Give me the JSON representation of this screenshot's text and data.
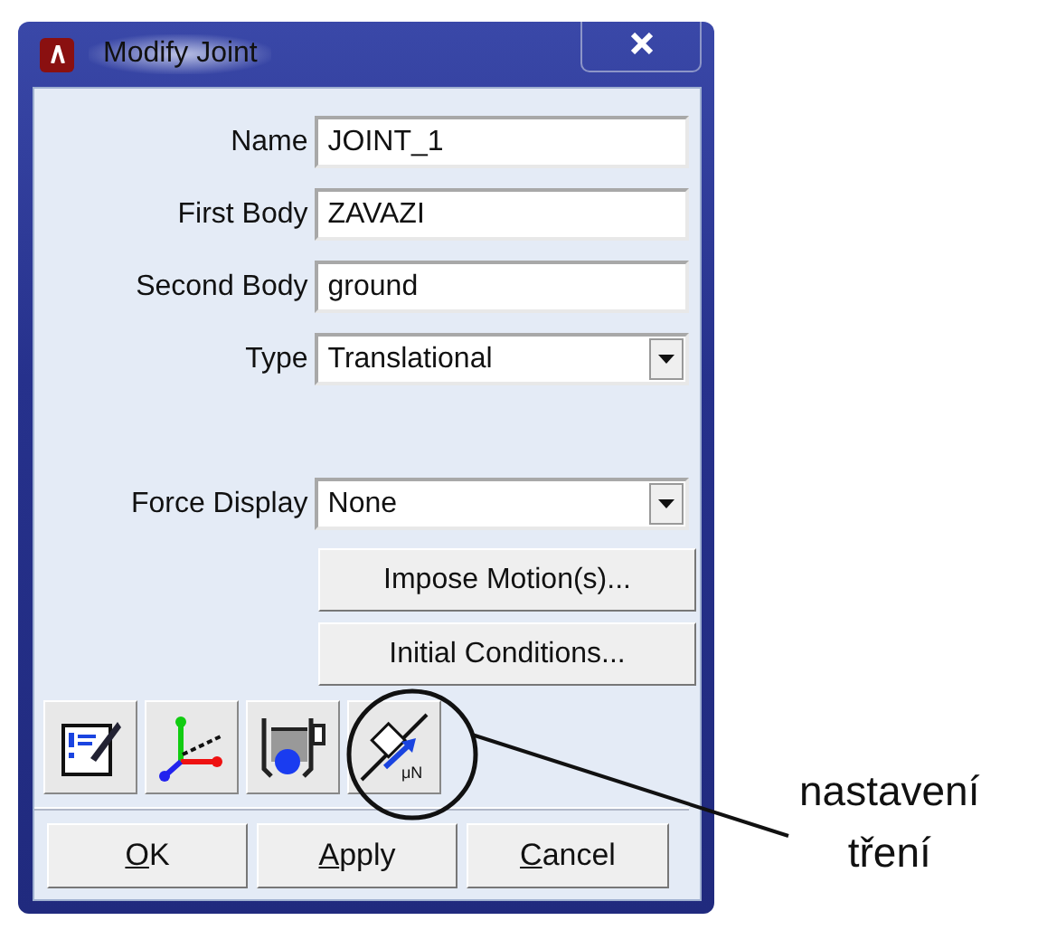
{
  "window": {
    "title": "Modify Joint"
  },
  "fields": [
    {
      "label": "Name",
      "kind": "text",
      "value": "JOINT_1"
    },
    {
      "label": "First Body",
      "kind": "text",
      "value": "ZAVAZI"
    },
    {
      "label": "Second Body",
      "kind": "text",
      "value": "ground"
    },
    {
      "label": "Type",
      "kind": "select",
      "value": "Translational"
    },
    {
      "label": "Force Display",
      "kind": "select",
      "value": "None"
    }
  ],
  "action_buttons": [
    "Impose Motion(s)...",
    "Initial Conditions..."
  ],
  "tool_icons": [
    {
      "kind": "notes"
    },
    {
      "kind": "axes"
    },
    {
      "kind": "fixture"
    },
    {
      "kind": "friction",
      "caption": "μN",
      "highlighted": true
    }
  ],
  "dialog_buttons": [
    "OK",
    "Apply",
    "Cancel"
  ],
  "annotation": {
    "lines": [
      "nastavení",
      "tření"
    ]
  }
}
